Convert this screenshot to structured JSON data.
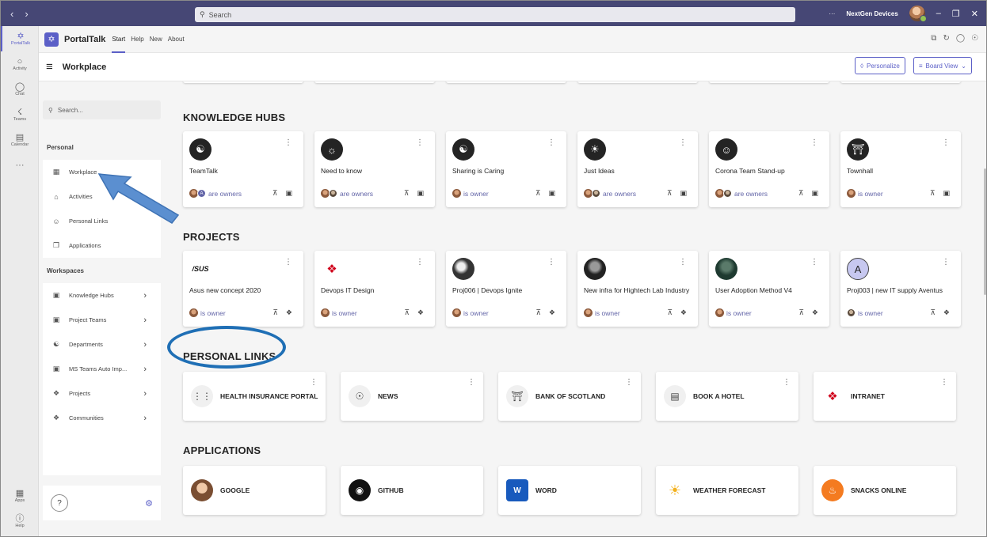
{
  "titlebar": {
    "search_placeholder": "Search",
    "org_name": "NextGen Devices",
    "more": "···"
  },
  "rail": {
    "items": [
      {
        "label": "PortalTalk",
        "icon": "portaltalk-icon"
      },
      {
        "label": "Activity",
        "icon": "bell-icon"
      },
      {
        "label": "Chat",
        "icon": "chat-icon"
      },
      {
        "label": "Teams",
        "icon": "teams-icon"
      },
      {
        "label": "Calendar",
        "icon": "calendar-icon"
      }
    ],
    "more": "···",
    "bottom": [
      {
        "label": "Apps",
        "icon": "apps-icon"
      },
      {
        "label": "Help",
        "icon": "help-icon"
      }
    ]
  },
  "app": {
    "name": "PortalTalk",
    "tabs": [
      "Start",
      "Help",
      "New",
      "About"
    ],
    "active_tab": "Start"
  },
  "workplace": {
    "title": "Workplace",
    "personalize_label": "Personalize",
    "board_view_label": "Board View"
  },
  "sidebar": {
    "search_placeholder": "Search...",
    "personal_heading": "Personal",
    "personal_items": [
      "Workplace",
      "Activities",
      "Personal Links",
      "Applications"
    ],
    "workspaces_heading": "Workspaces",
    "workspace_items": [
      "Knowledge Hubs",
      "Project Teams",
      "Departments",
      "MS Teams Auto Imp...",
      "Projects",
      "Communities"
    ],
    "help": "?"
  },
  "knowledge_hubs": {
    "title": "KNOWLEDGE HUBS",
    "cards": [
      {
        "title": "TeamTalk",
        "owner": "are owners"
      },
      {
        "title": "Need to know",
        "owner": "are owners"
      },
      {
        "title": "Sharing is Caring",
        "owner": "is owner"
      },
      {
        "title": "Just Ideas",
        "owner": "are owners"
      },
      {
        "title": "Corona Team Stand-up",
        "owner": "are owners"
      },
      {
        "title": "Townhall",
        "owner": "is owner"
      }
    ]
  },
  "projects": {
    "title": "PROJECTS",
    "cards": [
      {
        "title": "Asus new concept 2020",
        "owner": "is owner"
      },
      {
        "title": "Devops IT Design",
        "owner": "is owner"
      },
      {
        "title": "Proj006 | Devops Ignite",
        "owner": "is owner"
      },
      {
        "title": "New infra for Hightech Lab Industry",
        "owner": "is owner"
      },
      {
        "title": "User Adoption Method V4",
        "owner": "is owner"
      },
      {
        "title": "Proj003 | new IT supply Aventus",
        "owner": "is owner"
      }
    ]
  },
  "personal_links": {
    "title": "PERSONAL LINKS",
    "items": [
      "HEALTH INSURANCE PORTAL",
      "NEWS",
      "BANK OF SCOTLAND",
      "BOOK A HOTEL",
      "INTRANET"
    ]
  },
  "applications": {
    "title": "APPLICATIONS",
    "items": [
      "GOOGLE",
      "GITHUB",
      "WORD",
      "WEATHER FORECAST",
      "SNACKS ONLINE"
    ]
  },
  "asus_logo": "/SUS",
  "avatar_letter": "A",
  "colors": {
    "titlebar": "#464775",
    "accent": "#5b5fc7",
    "annotation": "#1f6fb5"
  }
}
